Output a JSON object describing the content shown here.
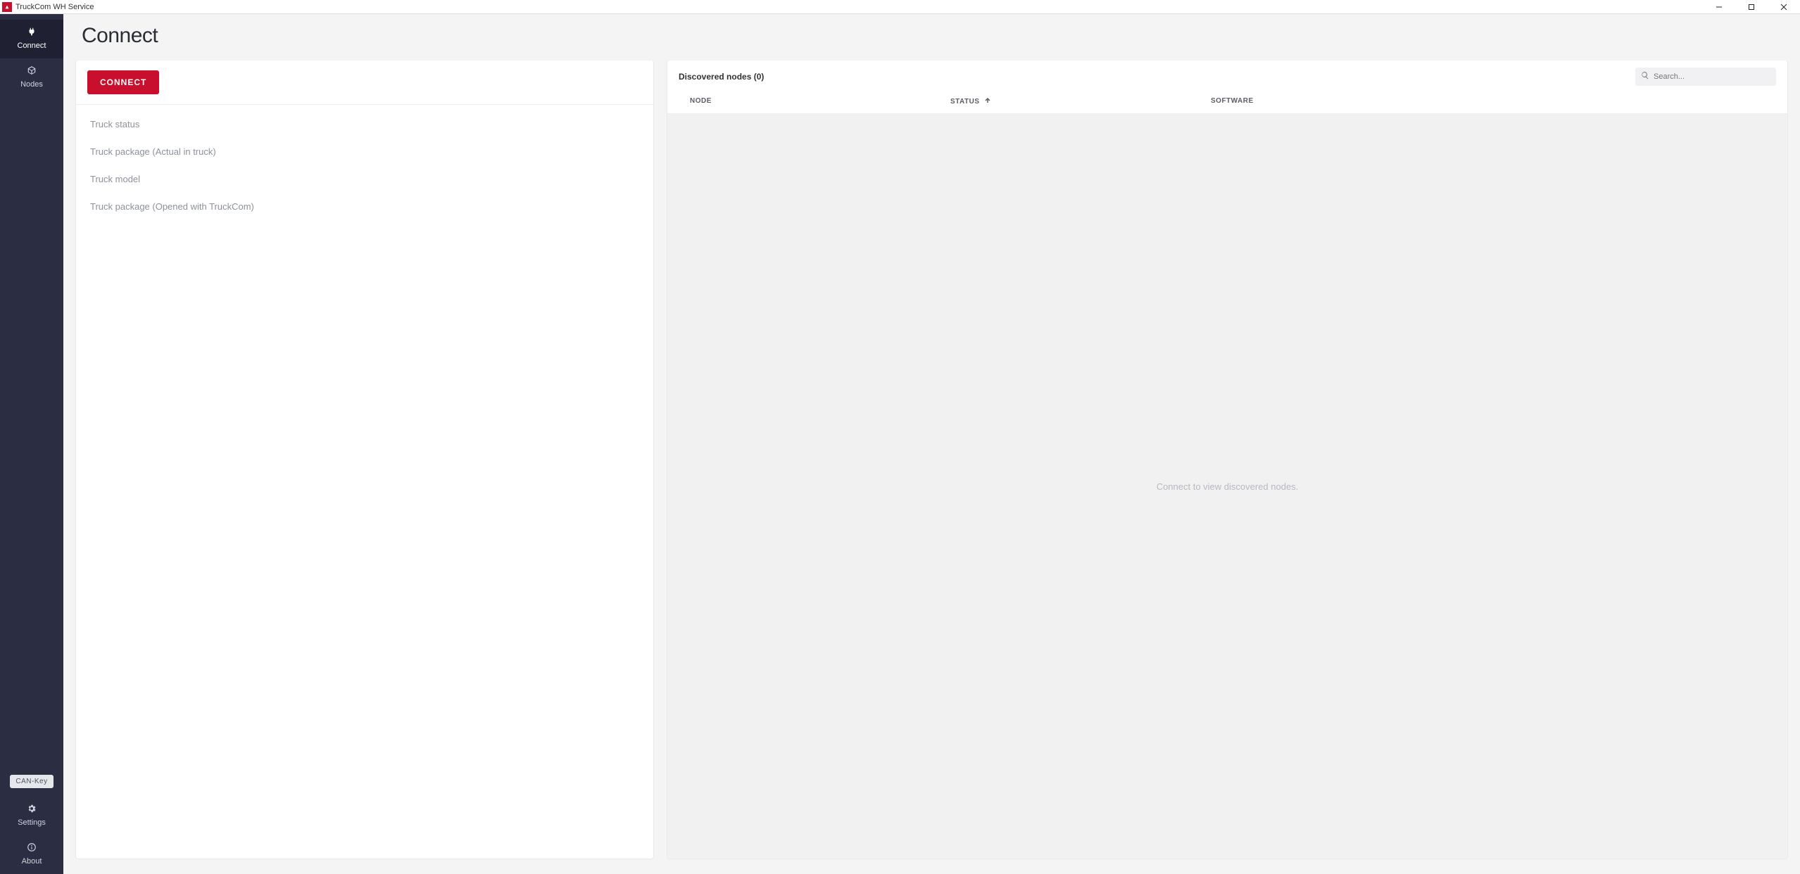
{
  "window": {
    "title": "TruckCom WH Service"
  },
  "sidebar": {
    "items": [
      {
        "label": "Connect"
      },
      {
        "label": "Nodes"
      }
    ],
    "can_key": "CAN-Key",
    "settings": "Settings",
    "about": "About"
  },
  "page": {
    "title": "Connect"
  },
  "connect_button": "CONNECT",
  "info_items": [
    "Truck status",
    "Truck package (Actual in truck)",
    "Truck model",
    "Truck package (Opened with TruckCom)"
  ],
  "discovered": {
    "title": "Discovered nodes (0)",
    "search_placeholder": "Search...",
    "columns": {
      "node": "NODE",
      "status": "STATUS",
      "software": "SOFTWARE"
    },
    "empty_message": "Connect to view discovered nodes."
  }
}
